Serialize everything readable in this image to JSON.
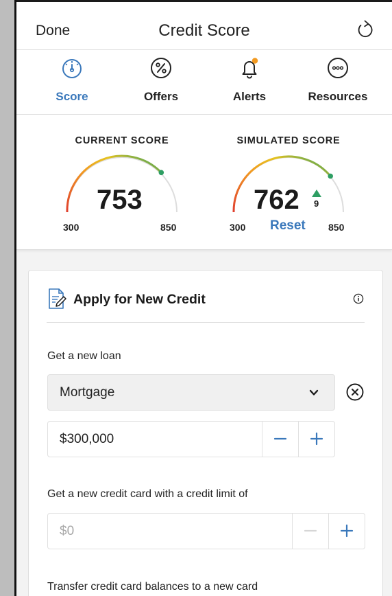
{
  "header": {
    "done_label": "Done",
    "title": "Credit Score",
    "refresh_icon": "refresh-icon"
  },
  "tabs": [
    {
      "label": "Score",
      "icon": "gauge-icon",
      "active": true
    },
    {
      "label": "Offers",
      "icon": "percent-icon",
      "active": false
    },
    {
      "label": "Alerts",
      "icon": "bell-icon",
      "active": false
    },
    {
      "label": "Resources",
      "icon": "more-icon",
      "active": false
    }
  ],
  "scores": {
    "current": {
      "heading": "CURRENT SCORE",
      "value": "753",
      "min": "300",
      "max": "850"
    },
    "simulated": {
      "heading": "SIMULATED SCORE",
      "value": "762",
      "change": "9",
      "reset_label": "Reset",
      "min": "300",
      "max": "850"
    }
  },
  "card": {
    "title": "Apply for New Credit",
    "loan": {
      "label": "Get a new loan",
      "selected": "Mortgage",
      "amount": "$300,000"
    },
    "credit_card": {
      "label": "Get a new credit card with a credit limit of",
      "placeholder": "$0"
    },
    "transfer": {
      "label": "Transfer credit card balances to a new card"
    }
  },
  "colors": {
    "accent": "#3a78bb",
    "gauge_red": "#e0402f",
    "gauge_orange": "#f29a22",
    "gauge_yellow": "#e6c21f",
    "gauge_green": "#2e9e63",
    "gauge_track": "#dddddd",
    "alert_dot": "#f29a22"
  }
}
